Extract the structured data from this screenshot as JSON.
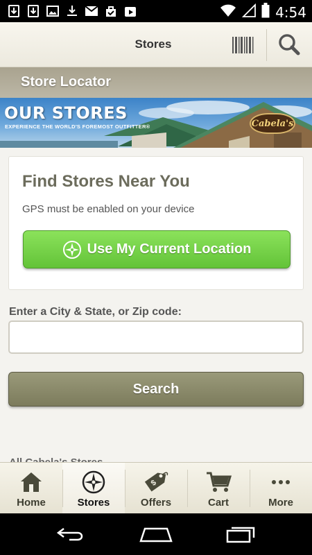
{
  "status_bar": {
    "time": "4:54",
    "left_icons": [
      "download-icon",
      "download-icon",
      "image-icon",
      "download-done-icon",
      "gmail-icon",
      "checked-bag-icon",
      "play-store-icon"
    ],
    "right_icons": [
      "wifi-icon",
      "signal-icon",
      "battery-icon"
    ]
  },
  "header": {
    "title": "Stores",
    "barcode_icon": "barcode-icon",
    "search_icon": "search-icon"
  },
  "locator_bar": {
    "title": "Store Locator"
  },
  "banner": {
    "title": "OUR STORES",
    "subtitle": "EXPERIENCE THE WORLD'S FOREMOST OUTFITTER®",
    "logo_text": "Cabela's"
  },
  "find_card": {
    "title": "Find Stores Near You",
    "subtitle": "GPS must be enabled on your device",
    "location_button_label": "Use My Current Location",
    "location_button_icon": "compass-icon",
    "button_color": "#6fd046"
  },
  "search_form": {
    "label": "Enter a City & State, or Zip code:",
    "input_value": "",
    "input_placeholder": "",
    "search_label": "Search",
    "search_color": "#8b8a6a"
  },
  "all_stores_label": "All Cabela's Stores",
  "tabs": [
    {
      "label": "Home",
      "icon": "home-icon",
      "active": false
    },
    {
      "label": "Stores",
      "icon": "compass-icon",
      "active": true
    },
    {
      "label": "Offers",
      "icon": "tag-icon",
      "active": false
    },
    {
      "label": "Cart",
      "icon": "cart-icon",
      "active": false
    },
    {
      "label": "More",
      "icon": "more-icon",
      "active": false
    }
  ],
  "nav_bar": {
    "icons": [
      "back-icon",
      "home-icon",
      "recent-apps-icon"
    ]
  }
}
